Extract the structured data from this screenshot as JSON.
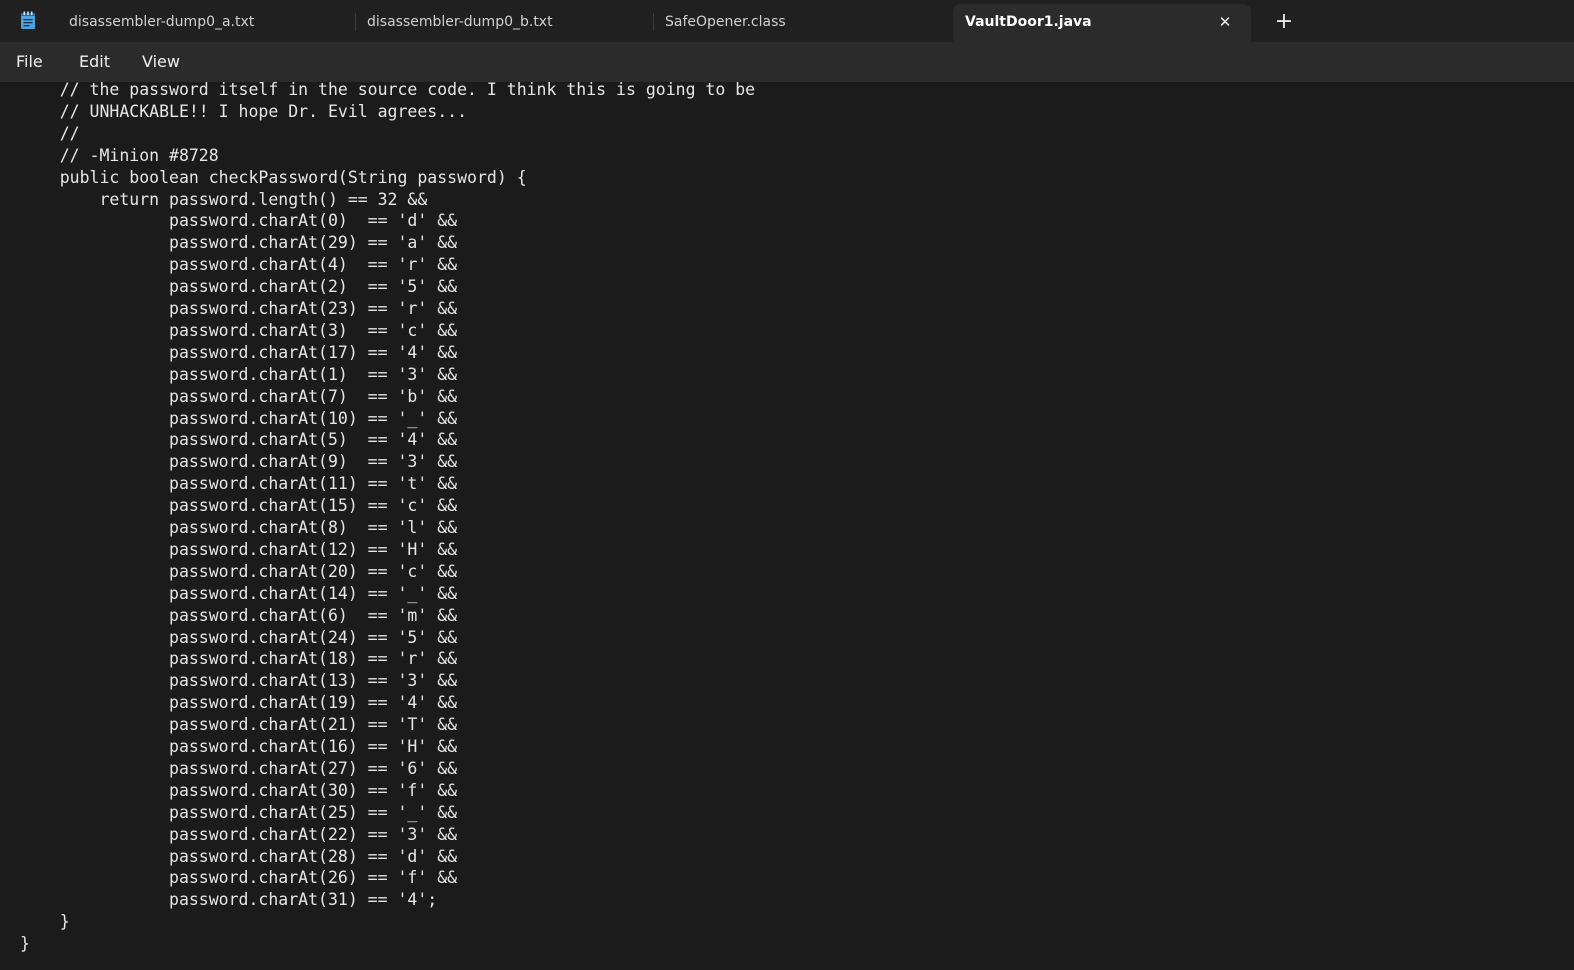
{
  "tabs": [
    {
      "label": "disassembler-dump0_a.txt"
    },
    {
      "label": "disassembler-dump0_b.txt"
    },
    {
      "label": "SafeOpener.class"
    },
    {
      "label": "VaultDoor1.java"
    }
  ],
  "menu": {
    "file": "File",
    "edit": "Edit",
    "view": "View"
  },
  "icons": {
    "app": "notepad-icon",
    "close": "close-icon",
    "new_tab": "plus-icon"
  },
  "glyphs": {
    "close": "✕",
    "new_tab": "+"
  },
  "editor": {
    "lines": [
      "    // the password itself in the source code. I think this is going to be",
      "    // UNHACKABLE!! I hope Dr. Evil agrees...",
      "    //",
      "    // -Minion #8728",
      "    public boolean checkPassword(String password) {",
      "        return password.length() == 32 &&",
      "               password.charAt(0)  == 'd' &&",
      "               password.charAt(29) == 'a' &&",
      "               password.charAt(4)  == 'r' &&",
      "               password.charAt(2)  == '5' &&",
      "               password.charAt(23) == 'r' &&",
      "               password.charAt(3)  == 'c' &&",
      "               password.charAt(17) == '4' &&",
      "               password.charAt(1)  == '3' &&",
      "               password.charAt(7)  == 'b' &&",
      "               password.charAt(10) == '_' &&",
      "               password.charAt(5)  == '4' &&",
      "               password.charAt(9)  == '3' &&",
      "               password.charAt(11) == 't' &&",
      "               password.charAt(15) == 'c' &&",
      "               password.charAt(8)  == 'l' &&",
      "               password.charAt(12) == 'H' &&",
      "               password.charAt(20) == 'c' &&",
      "               password.charAt(14) == '_' &&",
      "               password.charAt(6)  == 'm' &&",
      "               password.charAt(24) == '5' &&",
      "               password.charAt(18) == 'r' &&",
      "               password.charAt(13) == '3' &&",
      "               password.charAt(19) == '4' &&",
      "               password.charAt(21) == 'T' &&",
      "               password.charAt(16) == 'H' &&",
      "               password.charAt(27) == '6' &&",
      "               password.charAt(30) == 'f' &&",
      "               password.charAt(25) == '_' &&",
      "               password.charAt(22) == '3' &&",
      "               password.charAt(28) == 'd' &&",
      "               password.charAt(26) == 'f' &&",
      "               password.charAt(31) == '4';",
      "    }",
      "}"
    ]
  }
}
